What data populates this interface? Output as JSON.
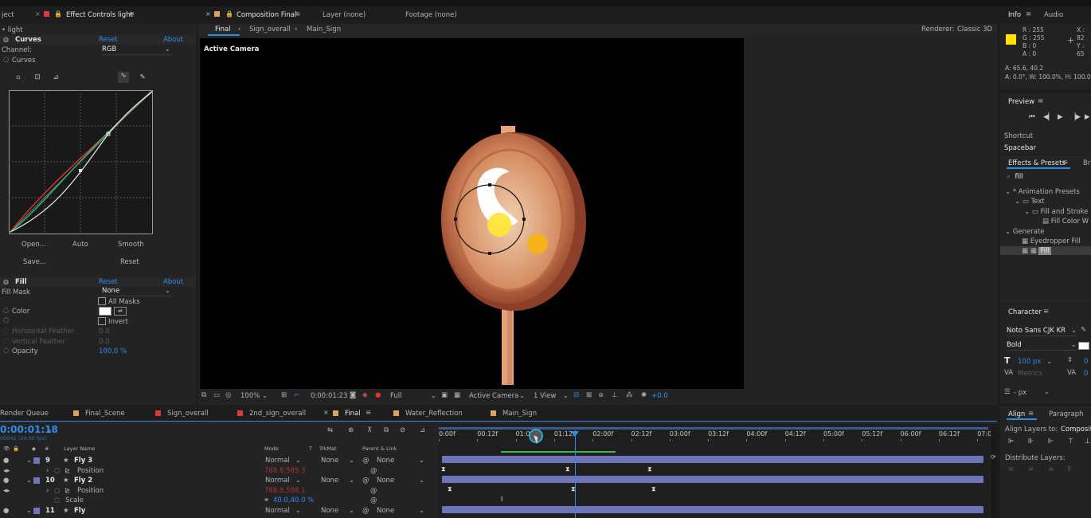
{
  "top_bar": {
    "left_tab": "ject",
    "effect_controls_tab": "Effect Controls light",
    "composition_tab": "Composition Final",
    "layer_tab": "Layer (none)",
    "footage_tab": "Footage (none)",
    "info_tab": "Info",
    "audio_tab": "Audio"
  },
  "effect_controls": {
    "layer_label": "• light",
    "curves": {
      "name": "Curves",
      "reset": "Reset",
      "about": "About",
      "channel_label": "Channel:",
      "channel_value": "RGB",
      "curves_label": "Curves",
      "open": "Open...",
      "auto": "Auto",
      "smooth": "Smooth",
      "save": "Save...",
      "reset_btn": "Reset"
    },
    "fill": {
      "name": "Fill",
      "reset": "Reset",
      "about": "About",
      "fill_mask_label": "Fill Mask",
      "fill_mask_value": "None",
      "all_masks": "All Masks",
      "color_label": "Color",
      "invert": "Invert",
      "horizontal_feather": "Horizontal Feather",
      "horizontal_feather_value": "0.0",
      "vertical_feather": "Vertical Feather",
      "vertical_feather_value": "0.0",
      "opacity_label": "Opacity",
      "opacity_value": "100.0 %"
    }
  },
  "composition": {
    "breadcrumb_final": "Final",
    "breadcrumb_sign": "Sign_overall",
    "breadcrumb_main": "Main_Sign",
    "renderer_label": "Renderer:",
    "renderer_value": "Classic 3D",
    "active_camera_label": "Active Camera",
    "footer": {
      "zoom": "100%",
      "timecode": "0:00:01:23",
      "resolution": "Full",
      "camera": "Active Camera",
      "view": "1 View",
      "exposure": "+0.0"
    }
  },
  "info_panel": {
    "r": "R : 255",
    "g": "G : 255",
    "b": "B : 0",
    "a": "A : 0",
    "x": "X : 82",
    "y": "Y : 65",
    "position_line": "A: 65.6, 40.2",
    "transform_line": "A: 0.0°, W: 100.0%, H: 100.0%",
    "swatch_color": "#ffe600"
  },
  "preview_panel": {
    "title": "Preview",
    "shortcut_label": "Shortcut",
    "shortcut_value": "Spacebar"
  },
  "effects_presets": {
    "title": "Effects & Presets",
    "next_tab": "Br",
    "search_value": "fill",
    "tree": [
      {
        "label": "* Animation Presets",
        "depth": 0,
        "kind": "folder-open"
      },
      {
        "label": "Text",
        "depth": 1,
        "kind": "folder-open"
      },
      {
        "label": "Fill and Stroke",
        "depth": 2,
        "kind": "folder-open"
      },
      {
        "label": "Fill Color W",
        "depth": 3,
        "kind": "preset"
      },
      {
        "label": "Generate",
        "depth": 0,
        "kind": "folder-open"
      },
      {
        "label": "Eyedropper Fill",
        "depth": 1,
        "kind": "effect"
      },
      {
        "label": "Fill",
        "depth": 1,
        "kind": "effect-selected"
      }
    ]
  },
  "character_panel": {
    "title": "Character",
    "font": "Noto Sans CJK KR",
    "style": "Bold",
    "size": "100 px",
    "metrics": "Metrics",
    "unit": "- px"
  },
  "align_panel": {
    "align_tab": "Align",
    "paragraph_tab": "Paragraph",
    "align_layers_to": "Align Layers to:",
    "align_target": "Compositi",
    "distribute_layers": "Distribute Layers:"
  },
  "timeline_tabs": [
    {
      "label": "Render Queue",
      "color": ""
    },
    {
      "label": "Final_Scene",
      "color": "#d9a45c"
    },
    {
      "label": "Sign_overall",
      "color": "#e0383d"
    },
    {
      "label": "2nd_sign_overall",
      "color": "#e0383d"
    },
    {
      "label": "Final",
      "color": "#d9a45c"
    },
    {
      "label": "Water_Reflection",
      "color": "#d9a45c"
    },
    {
      "label": "Main_Sign",
      "color": "#d9a45c"
    }
  ],
  "timeline": {
    "timecode": "0:00:01:18",
    "fps": "00042 (24.00 fps)",
    "columns": {
      "hash": "#",
      "layer_name": "Layer Name",
      "mode": "Mode",
      "t": "T",
      "trkmat": "TrkMat",
      "parent": "Parent & Link"
    },
    "ruler": [
      "0:00f",
      "00:12f",
      "01:00f",
      "01:12f",
      "02:00f",
      "02:12f",
      "03:00f",
      "03:12f",
      "04:00f",
      "04:12f",
      "05:00f",
      "05:12f",
      "06:00f",
      "06:12f",
      "07:00"
    ],
    "layers": [
      {
        "num": "9",
        "name": "Fly 3",
        "mode": "Normal",
        "trkmat": "None",
        "parent": "None",
        "label_color": "#6f74b8"
      },
      {
        "prop": "Position",
        "value": "788.8,585.3"
      },
      {
        "num": "10",
        "name": "Fly 2",
        "mode": "Normal",
        "trkmat": "None",
        "parent": "None",
        "label_color": "#6f74b8"
      },
      {
        "prop": "Position",
        "value": "788.8,588.1"
      },
      {
        "prop": "Scale",
        "value": "40.0,40.0 %"
      },
      {
        "num": "11",
        "name": "Fly",
        "mode": "Normal",
        "trkmat": "None",
        "parent": "None",
        "label_color": "#6f74b8"
      }
    ]
  }
}
